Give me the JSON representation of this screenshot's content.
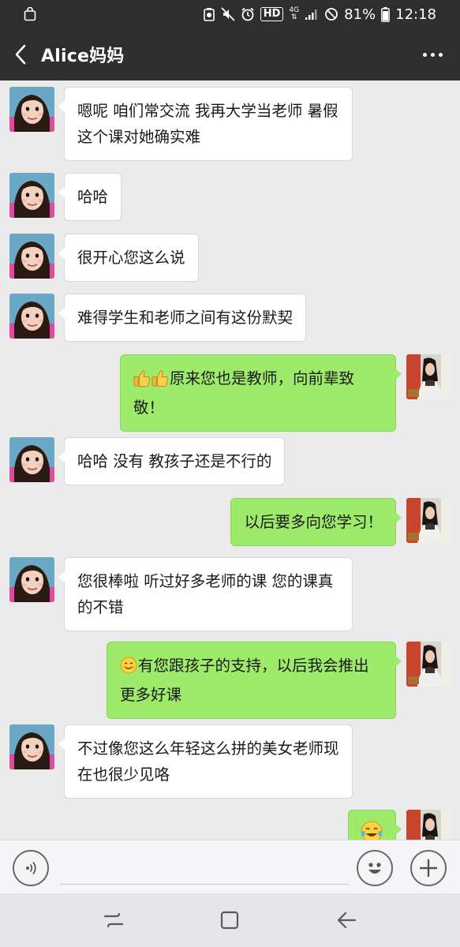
{
  "status_bar": {
    "battery": "81%",
    "time": "12:18",
    "hd_label": "HD",
    "network": "4G"
  },
  "header": {
    "title": "Alice妈妈"
  },
  "messages": [
    {
      "side": "in",
      "text": "嗯呢 咱们常交流 我再大学当老师 暑假这个课对她确实难"
    },
    {
      "side": "in",
      "text": "哈哈"
    },
    {
      "side": "in",
      "text": "很开心您这么说"
    },
    {
      "side": "in",
      "text": "难得学生和老师之间有这份默契"
    },
    {
      "side": "out",
      "emoji": "thumbs-up-x2",
      "text": "原来您也是教师，向前辈致敬！"
    },
    {
      "side": "in",
      "text": "哈哈 没有 教孩子还是不行的"
    },
    {
      "side": "out",
      "text": "以后要多向您学习！"
    },
    {
      "side": "in",
      "text": "您很棒啦 听过好多老师的课 您的课真的不错"
    },
    {
      "side": "out",
      "emoji": "smile",
      "text": "有您跟孩子的支持，以后我会推出更多好课"
    },
    {
      "side": "in",
      "text": "不过像您这么年轻这么拼的美女老师现在也很少见咯"
    },
    {
      "side": "out",
      "emoji": "tears-of-joy",
      "text": ""
    }
  ],
  "input": {
    "value": "",
    "placeholder": ""
  },
  "colors": {
    "header_bg": "#2e2e2e",
    "chat_bg": "#ebebeb",
    "bubble_in": "#ffffff",
    "bubble_out": "#9eea6a",
    "nav_bg": "#e6e6ea"
  }
}
